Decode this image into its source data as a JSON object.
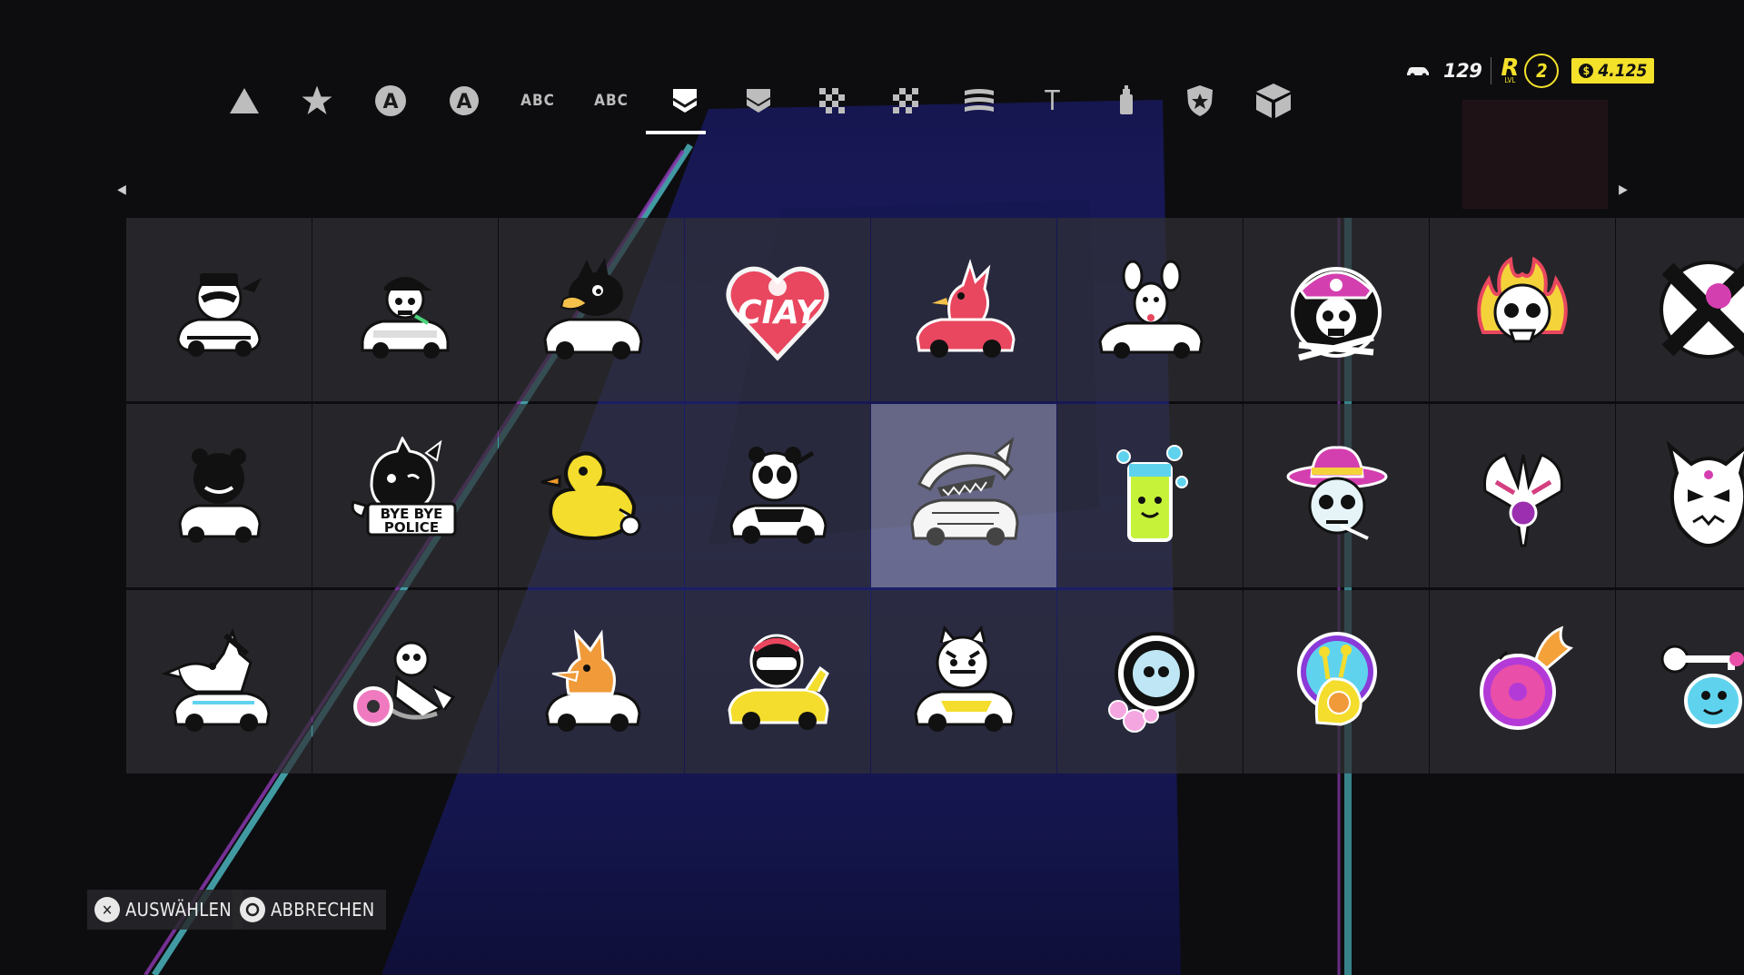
{
  "hud": {
    "cars_icon": "car-icon",
    "cars_count": "129",
    "rep_letter": "R",
    "rep_sub": "LVL",
    "rep_level": "2",
    "cash_icon": "$",
    "cash_amount": "4.125"
  },
  "tabs": {
    "labels": [
      "ABC",
      "ABC",
      "T"
    ],
    "active_index": 6,
    "icons": [
      "triangle-icon",
      "star-icon",
      "circle-a-icon",
      "circle-a-outline-icon",
      "abc-text",
      "abc-text",
      "sticker-icon",
      "sticker-outline-icon",
      "checker-icon",
      "checker-outline-icon",
      "stripes-icon",
      "t-text",
      "spray-can-icon",
      "police-badge-icon",
      "box-icon"
    ]
  },
  "grid": {
    "selected": "row2-col5",
    "stickers": [
      [
        "raccoon-car-sticker",
        "skull-cap-car-sticker",
        "duck-car-sticker",
        "ciay-heart-sticker",
        "red-bird-car-sticker",
        "mouse-car-sticker",
        "pirate-skull-sticker",
        "flaming-skull-sticker",
        "x-graffiti-sticker"
      ],
      [
        "bear-car-sticker",
        "bye-bye-police-cat-sticker",
        "rubber-duck-sticker",
        "panda-car-sticker",
        "shark-car-sticker",
        "bubble-drink-sticker",
        "pimp-skull-sticker",
        "eagle-sticker",
        "demon-mask-sticker"
      ],
      [
        "wolf-car-sticker",
        "skeleton-donut-sticker",
        "fox-car-sticker",
        "helmet-car-sticker",
        "tiger-car-sticker",
        "skull-circle-sticker",
        "snail-sticker",
        "donut-flame-sticker",
        "key-ghost-sticker"
      ]
    ],
    "texts": {
      "ciay": "CIAY",
      "bye_bye": "BYE BYE",
      "police": "POLICE"
    }
  },
  "hints": {
    "select_icon": "cross-button-icon",
    "select_label": "AUSWÄHLEN",
    "cancel_icon": "circle-button-icon",
    "cancel_label": "ABBRECHEN"
  },
  "colors": {
    "accent_yellow": "#f4e12a",
    "selected_cell": "#a9a9ae",
    "cell": "#303034",
    "neon_cyan": "#5fe3ee",
    "neon_purple": "#c04cf2"
  }
}
